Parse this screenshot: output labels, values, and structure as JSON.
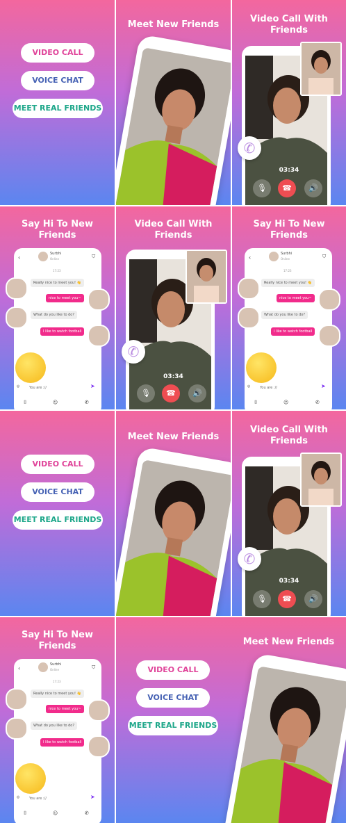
{
  "pills": {
    "video_call": "VIDEO CALL",
    "voice_chat": "VOICE CHAT",
    "meet_real": "MEET REAL FRIENDS"
  },
  "headings": {
    "meet": "Meet New Friends",
    "video_l1": "Video Call With",
    "video_l2": "Friends",
    "sayhi_l1": "Say Hi To New",
    "sayhi_l2": "Friends"
  },
  "call": {
    "timer": "03:34"
  },
  "chat": {
    "contact_name": "Surbhi",
    "contact_status": "Online",
    "time": "17:23",
    "messages": [
      {
        "dir": "in",
        "text": "Really nice to meet you! 👋"
      },
      {
        "dir": "out",
        "text": "nice to meet you~"
      },
      {
        "dir": "in",
        "text": "What do you like to do?"
      },
      {
        "dir": "out",
        "text": "I like to watch football"
      }
    ],
    "input_value": "You are ://"
  },
  "colors": {
    "video_pill_text": "#e0449a",
    "voice_pill_text": "#4662b4",
    "real_pill_text": "#1ea78a",
    "end_call": "#ef4d52",
    "chat_out_bubble": "#f12b8b"
  },
  "icons": [
    "back-arrow-icon",
    "shield-icon",
    "mic-mute-icon",
    "end-call-icon",
    "speaker-icon",
    "phone-handset-icon",
    "send-icon",
    "camera-icon",
    "emoji-icon",
    "call-icon",
    "voice-icon"
  ]
}
